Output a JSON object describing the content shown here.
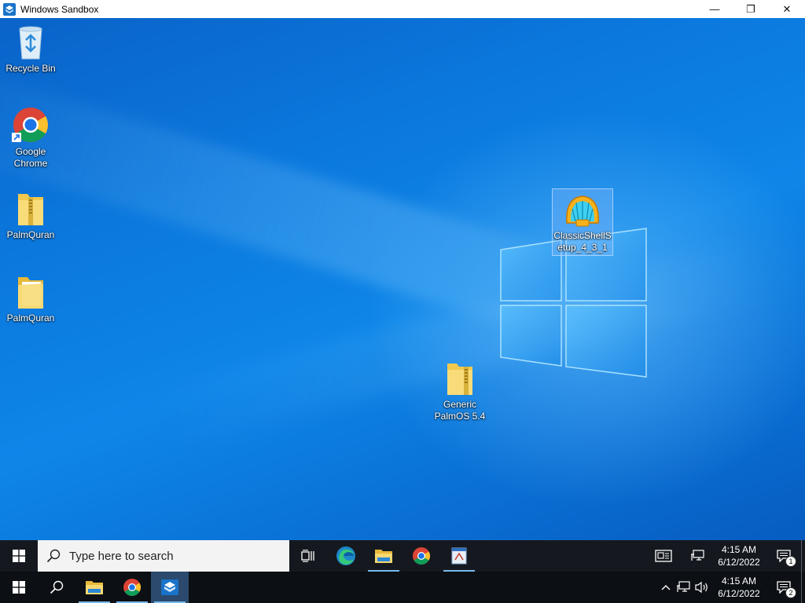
{
  "window": {
    "title": "Windows Sandbox",
    "minimize": "—",
    "maximize": "❐",
    "close": "✕"
  },
  "desktop_icons": [
    {
      "name": "recycle-bin",
      "label": "Recycle Bin"
    },
    {
      "name": "google-chrome",
      "label": "Google Chrome"
    },
    {
      "name": "palmquran-zip",
      "label": "PalmQuran"
    },
    {
      "name": "palmquran-folder",
      "label": "PalmQuran"
    },
    {
      "name": "classicshell",
      "label": "ClassicShellSetup_4_3_1",
      "selected": true
    },
    {
      "name": "generic-palmos",
      "label": "Generic PalmOS 5.4"
    }
  ],
  "inner_taskbar": {
    "search_placeholder": "Type here to search",
    "pinned": [
      "task-view",
      "edge",
      "file-explorer",
      "chrome",
      "app"
    ],
    "time": "4:15 AM",
    "date": "6/12/2022",
    "notification_count": "1"
  },
  "outer_taskbar": {
    "pinned": [
      "search",
      "file-explorer",
      "chrome",
      "windows-sandbox"
    ],
    "time": "4:15 AM",
    "date": "6/12/2022",
    "notification_count": "2"
  },
  "colors": {
    "accent": "#76b9ed",
    "desktop": "#0b78dd",
    "taskbar": "#15191f"
  }
}
